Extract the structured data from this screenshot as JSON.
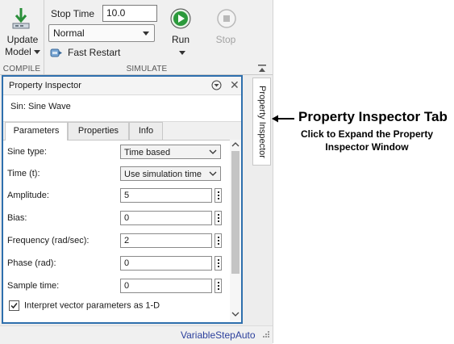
{
  "ribbon": {
    "compile": {
      "update_button": {
        "line1": "Update",
        "line2": "Model",
        "icon": "download-arrow-icon"
      },
      "section_label": "COMPILE"
    },
    "simulate": {
      "stop_time_label": "Stop Time",
      "stop_time_value": "10.0",
      "mode_value": "Normal",
      "fast_restart_label": "Fast Restart",
      "run_label": "Run",
      "stop_label": "Stop",
      "section_label": "SIMULATE"
    }
  },
  "property_inspector": {
    "title": "Property Inspector",
    "block_name": "Sin: Sine Wave",
    "tabs": [
      {
        "label": "Parameters",
        "active": true
      },
      {
        "label": "Properties",
        "active": false
      },
      {
        "label": "Info",
        "active": false
      }
    ],
    "params": {
      "sine_type": {
        "label": "Sine type:",
        "value": "Time based"
      },
      "time": {
        "label": "Time (t):",
        "value": "Use simulation time"
      },
      "amplitude": {
        "label": "Amplitude:",
        "value": "5"
      },
      "bias": {
        "label": "Bias:",
        "value": "0"
      },
      "frequency": {
        "label": "Frequency (rad/sec):",
        "value": "2"
      },
      "phase": {
        "label": "Phase (rad):",
        "value": "0"
      },
      "sample_time": {
        "label": "Sample time:",
        "value": "0"
      }
    },
    "interpret_vector": {
      "label": "Interpret vector parameters as 1-D",
      "checked": true
    }
  },
  "status_bar": {
    "solver": "VariableStepAuto"
  },
  "side_tab": {
    "label": "Property Inspector"
  },
  "annotation": {
    "title": "Property Inspector Tab",
    "subtitle": "Click to Expand the Property Inspector Window"
  },
  "colors": {
    "panel_border": "#2e6fad",
    "run_green": "#2b9a3b",
    "status_text": "#2b3f9c"
  }
}
